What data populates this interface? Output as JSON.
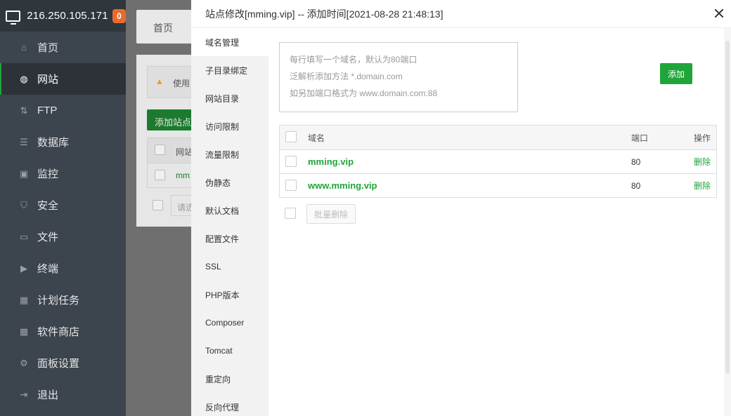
{
  "sidebar": {
    "ip": "216.250.105.171",
    "badge": "0",
    "items": [
      {
        "label": "首页",
        "icon": "home-icon"
      },
      {
        "label": "网站",
        "icon": "globe-icon"
      },
      {
        "label": "FTP",
        "icon": "ftp-icon"
      },
      {
        "label": "数据库",
        "icon": "database-icon"
      },
      {
        "label": "监控",
        "icon": "monitor-icon"
      },
      {
        "label": "安全",
        "icon": "shield-icon"
      },
      {
        "label": "文件",
        "icon": "folder-icon"
      },
      {
        "label": "终端",
        "icon": "terminal-icon"
      },
      {
        "label": "计划任务",
        "icon": "calendar-icon"
      },
      {
        "label": "软件商店",
        "icon": "apps-icon"
      },
      {
        "label": "面板设置",
        "icon": "gear-icon"
      },
      {
        "label": "退出",
        "icon": "logout-icon"
      }
    ],
    "active_index": 1
  },
  "background": {
    "breadcrumb": "首页",
    "warning": "使用",
    "add_site": "添加站点",
    "col_site": "网站",
    "row_site": "mm",
    "search_placeholder": "请选"
  },
  "modal": {
    "title": "站点修改[mming.vip] -- 添加时间[2021-08-28 21:48:13]",
    "tabs": [
      "域名管理",
      "子目录绑定",
      "网站目录",
      "访问限制",
      "流量限制",
      "伪静态",
      "默认文档",
      "配置文件",
      "SSL",
      "PHP版本",
      "Composer",
      "Tomcat",
      "重定向",
      "反向代理"
    ],
    "active_tab": 0,
    "textarea_lines": [
      "每行填写一个域名，默认为80端口",
      "泛解析添加方法 *.domain.com",
      "如另加端口格式为 www.domain.com:88"
    ],
    "add_button": "添加",
    "table": {
      "headers": {
        "name": "域名",
        "port": "端口",
        "op": "操作"
      },
      "rows": [
        {
          "name": "mming.vip",
          "port": "80",
          "op": "删除"
        },
        {
          "name": "www.mming.vip",
          "port": "80",
          "op": "删除"
        }
      ]
    },
    "bulk_delete": "批量删除"
  },
  "colors": {
    "accent": "#20a53a",
    "sidebar_bg": "#3c444d",
    "badge": "#e96a2c"
  }
}
